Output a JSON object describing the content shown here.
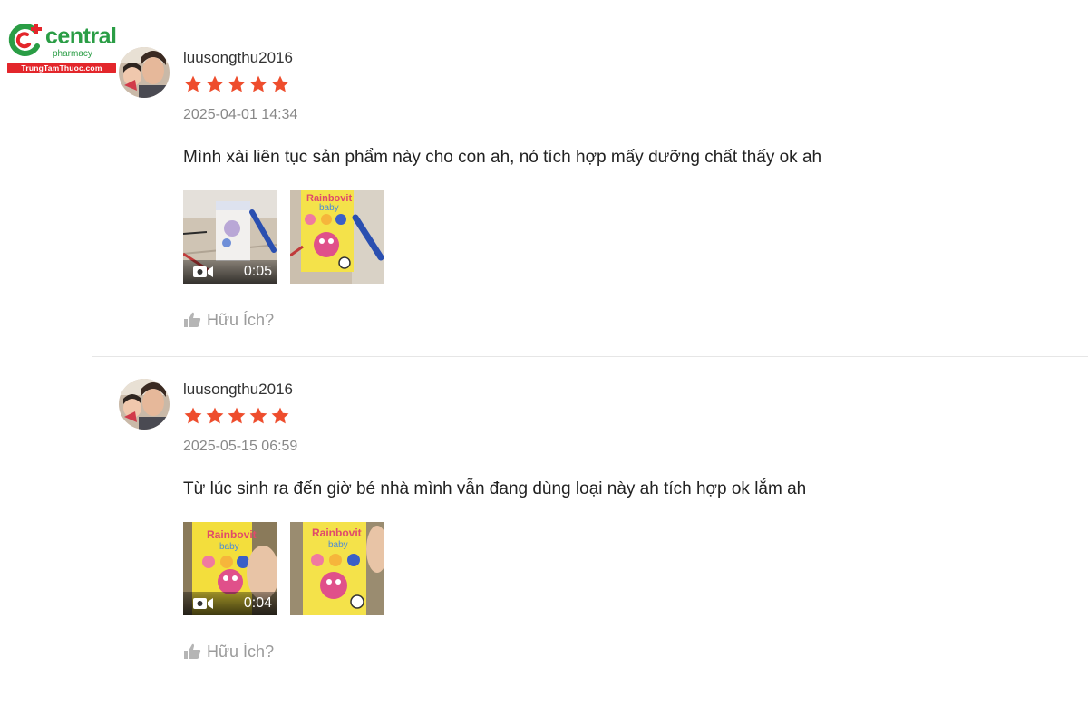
{
  "brand": {
    "name": "central",
    "sub": "pharmacy",
    "domain": "TrungTamThuoc.com",
    "colors": {
      "green": "#2a9d45",
      "red": "#e3262b"
    }
  },
  "reviews": [
    {
      "username": "luusongthu2016",
      "rating": 5,
      "date": "2025-04-01 14:34",
      "comment": "Mình xài liên tục sản phẩm này cho con ah, nó tích hợp mấy dưỡng chất thấy ok ah",
      "video_duration": "0:05",
      "helpful_label": "Hữu Ích?"
    },
    {
      "username": "luusongthu2016",
      "rating": 5,
      "date": "2025-05-15 06:59",
      "comment": "Từ lúc sinh ra đến giờ bé nhà mình vẫn đang dùng loại này ah  tích hợp ok lắm ah",
      "video_duration": "0:04",
      "helpful_label": "Hữu Ích?"
    }
  ],
  "product_box": {
    "brand_a": "Rainbovit",
    "brand_b": "baby",
    "badges": [
      "DHA",
      "K2",
      "D3"
    ]
  },
  "colors": {
    "star": "#ee4d2d",
    "muted": "#888888"
  }
}
